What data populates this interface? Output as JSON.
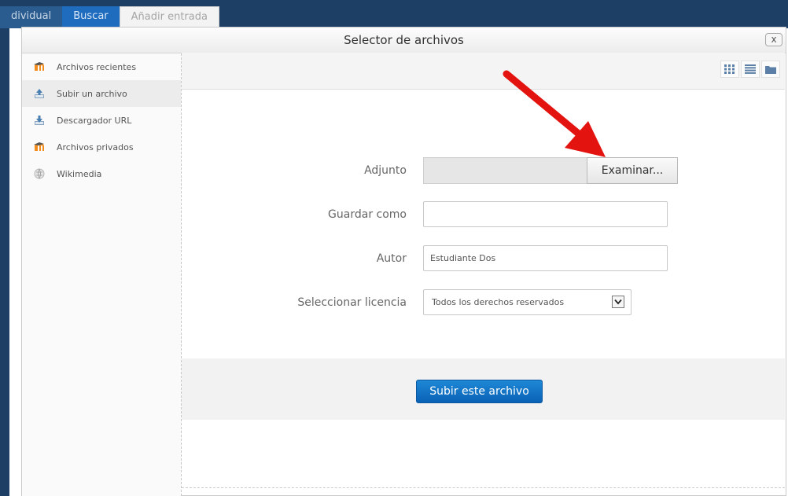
{
  "background": {
    "tabs": [
      "dividual",
      "Buscar",
      "Añadir entrada"
    ]
  },
  "dialog": {
    "title": "Selector de archivos",
    "close_label": "x"
  },
  "sidebar": {
    "items": [
      {
        "label": "Archivos recientes",
        "icon": "moodle-icon",
        "active": false
      },
      {
        "label": "Subir un archivo",
        "icon": "upload-icon",
        "active": true
      },
      {
        "label": "Descargador URL",
        "icon": "download-icon",
        "active": false
      },
      {
        "label": "Archivos privados",
        "icon": "moodle-icon",
        "active": false
      },
      {
        "label": "Wikimedia",
        "icon": "wikimedia-icon",
        "active": false
      }
    ]
  },
  "toolbar": {
    "view_buttons": [
      "grid-view-icon",
      "list-view-icon",
      "folder-view-icon"
    ]
  },
  "form": {
    "attachment_label": "Adjunto",
    "browse_label": "Examinar...",
    "save_as_label": "Guardar como",
    "save_as_value": "",
    "author_label": "Autor",
    "author_value": "Estudiante Dos",
    "license_label": "Seleccionar licencia",
    "license_value": "Todos los derechos reservados"
  },
  "actions": {
    "upload_label": "Subir este archivo"
  },
  "colors": {
    "accent": "#0a61b5",
    "header_bg": "#1d3f66",
    "annotation": "#e3130f"
  }
}
